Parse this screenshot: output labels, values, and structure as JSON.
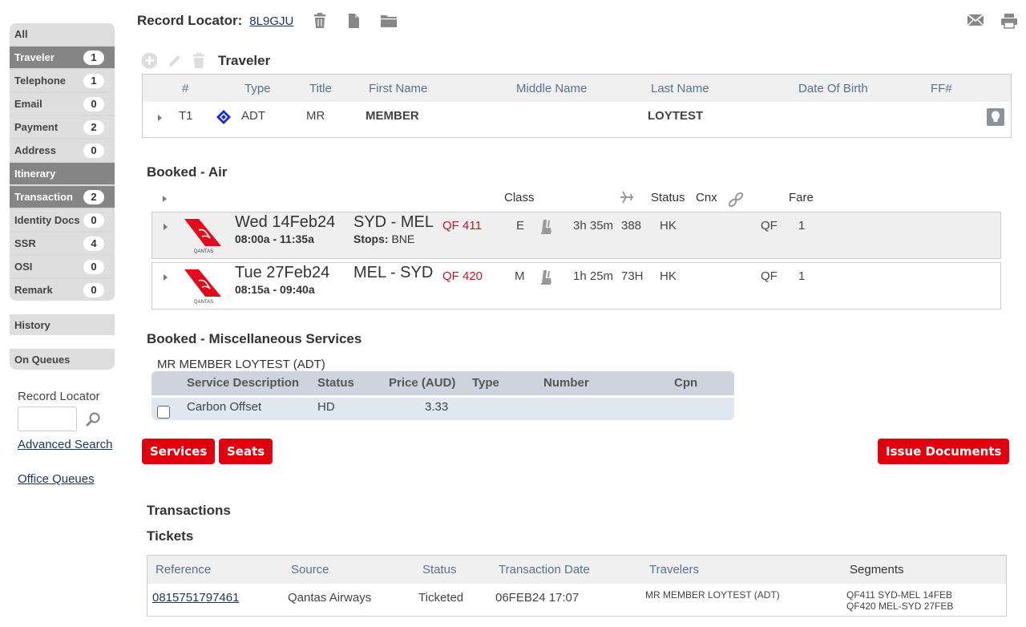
{
  "sidebar": {
    "items": [
      {
        "label": "All",
        "count": null
      },
      {
        "label": "Traveler",
        "count": "1"
      },
      {
        "label": "Telephone",
        "count": "1"
      },
      {
        "label": "Email",
        "count": "0"
      },
      {
        "label": "Payment",
        "count": "2"
      },
      {
        "label": "Address",
        "count": "0"
      },
      {
        "label": "Itinerary",
        "count": null
      },
      {
        "label": "Transaction",
        "count": "2"
      },
      {
        "label": "Identity Docs",
        "count": "0"
      },
      {
        "label": "SSR",
        "count": "4"
      },
      {
        "label": "OSI",
        "count": "0"
      },
      {
        "label": "Remark",
        "count": "0"
      }
    ],
    "history": "History",
    "on_queues": "On Queues",
    "search_label": "Record Locator",
    "search_value": "",
    "advanced_search": "Advanced Search",
    "office_queues": "Office Queues"
  },
  "header": {
    "record_locator_label": "Record Locator:",
    "record_locator_value": "8L9GJU",
    "icons": [
      "trash-icon",
      "document-icon",
      "folder-icon",
      "mail-icon",
      "print-icon"
    ]
  },
  "traveler": {
    "title": "Traveler",
    "columns": [
      "#",
      "Type",
      "Title",
      "First Name",
      "Middle Name",
      "Last Name",
      "Date Of Birth",
      "FF#"
    ],
    "rows": [
      {
        "num": "T1",
        "type": "ADT",
        "title": "MR",
        "first": "MEMBER",
        "middle": "",
        "last": "LOYTEST",
        "dob": "",
        "ff": ""
      }
    ]
  },
  "air": {
    "title": "Booked - Air",
    "columns": {
      "class": "Class",
      "status": "Status",
      "cnx": "Cnx",
      "fare": "Fare"
    },
    "segments": [
      {
        "date": "Wed 14Feb24",
        "time": "08:00a - 11:35a",
        "route": "SYD - MEL",
        "stops_label": "Stops:",
        "stops": "BNE",
        "flight": "QF 411",
        "class": "E",
        "duration": "3h 35m",
        "equipment": "388",
        "status": "HK",
        "fare_carrier": "QF",
        "fare": "1",
        "airline": "QANTAS"
      },
      {
        "date": "Tue 27Feb24",
        "time": "08:15a - 09:40a",
        "route": "MEL - SYD",
        "stops_label": "",
        "stops": "",
        "flight": "QF 420",
        "class": "M",
        "duration": "1h 25m",
        "equipment": "73H",
        "status": "HK",
        "fare_carrier": "QF",
        "fare": "1",
        "airline": "QANTAS"
      }
    ]
  },
  "misc": {
    "title": "Booked - Miscellaneous Services",
    "passenger": "MR MEMBER LOYTEST (ADT)",
    "columns": [
      "Service Description",
      "Status",
      "Price (AUD)",
      "Type",
      "Number",
      "Cpn"
    ],
    "rows": [
      {
        "description": "Carbon Offset",
        "status": "HD",
        "price": "3.33",
        "type": "",
        "number": "",
        "cpn": "",
        "checked": false
      }
    ]
  },
  "buttons": {
    "services": "Services",
    "seats": "Seats",
    "issue": "Issue Documents"
  },
  "transactions": {
    "title": "Transactions",
    "tickets_title": "Tickets",
    "columns": [
      "Reference",
      "Source",
      "Status",
      "Transaction Date",
      "Travelers",
      "Segments"
    ],
    "rows": [
      {
        "reference": "0815751797461",
        "source": "Qantas Airways",
        "status": "Ticketed",
        "date": "06FEB24 17:07",
        "travelers": "MR MEMBER LOYTEST (ADT)",
        "segments": [
          "QF411 SYD-MEL 14FEB",
          "QF420 MEL-SYD 27FEB"
        ]
      }
    ]
  },
  "colors": {
    "accent_red": "#e0000e",
    "flight_red": "#c0142a",
    "nav_active": "#858585"
  }
}
